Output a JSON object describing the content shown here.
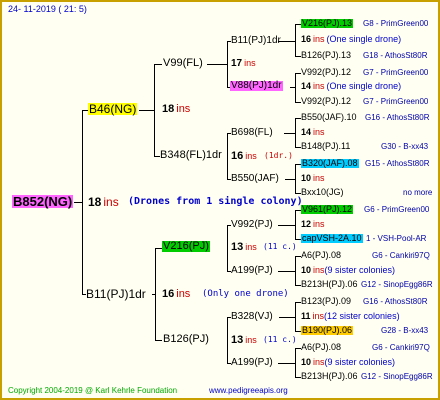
{
  "header": {
    "date": "24- 11-2019 ( 21: 5)"
  },
  "colors": {
    "yellow": "#ffff00",
    "green": "#00cc00",
    "magenta": "#ff66ff",
    "cyan": "#00ccff",
    "orange": "#ffcc00",
    "line": "#000000",
    "ins": "#cc0000",
    "note": "#0000cc",
    "frame": "#c8a000"
  },
  "queen": {
    "name": "B852(NG)",
    "ins_val": "18",
    "ins_word": "ins",
    "note": "(Drones from 1 single colony)"
  },
  "gen1": {
    "dam": {
      "name": "B46(NG)",
      "ins_val": "18",
      "ins_word": "ins"
    },
    "sire": {
      "name": "B11(PJ)1dr",
      "ins_val": "16",
      "ins_word": "ins",
      "note": "(Only one drone)"
    }
  },
  "gen2": {
    "d_dam": {
      "name": "V99(FL)"
    },
    "d_sire": {
      "name": "B348(FL)1dr",
      "ins_val": "16",
      "ins_word": "ins",
      "note": "(1dr.)"
    },
    "s_dam": {
      "name": "V216(PJ)",
      "ins_val": "13",
      "ins_word": "ins",
      "note": "(11 c.)"
    },
    "s_sire": {
      "name": "B126(PJ)",
      "ins_val": "13",
      "ins_word": "ins",
      "note": "(11 c.)"
    }
  },
  "gen3": {
    "a": {
      "name": "B11(PJ)1dr",
      "ins_val": "17",
      "ins_word": "ins"
    },
    "b": {
      "name": "V88(PJ)1dr"
    },
    "c": {
      "name": "B698(FL)",
      "ins_val": "14",
      "ins_word": "ins"
    },
    "d": {
      "name": "B550(JAF)",
      "ins_val": "10",
      "ins_word": "ins"
    },
    "e": {
      "name": "V992(PJ)",
      "ins_val": "12",
      "ins_word": "ins"
    },
    "f": {
      "name": "A199(PJ)",
      "ins_val": "10",
      "ins_word": "ins"
    },
    "g": {
      "name": "B328(VJ)",
      "ins_val": "13",
      "ins_word": "ins"
    },
    "h": {
      "name": "A199(PJ)",
      "ins_val": "10",
      "ins_word": "ins"
    }
  },
  "gen4": [
    {
      "name": "V216(PJ).13",
      "note": "G8 - PrimGreen00"
    },
    {
      "ins_val": "16",
      "ins_word": "ins",
      "note": "(One single drone)"
    },
    {
      "name": "B126(PJ).13",
      "note": "G18 - AthosSt80R"
    },
    {
      "name": "V992(PJ).12",
      "note": "G7 - PrimGreen00"
    },
    {
      "ins_val": "14",
      "ins_word": "ins",
      "note": "(One single drone)"
    },
    {
      "name": "V992(PJ).12",
      "note": "G7 - PrimGreen00"
    },
    {
      "name": "B550(JAF).10",
      "note": "G16 - AthosSt80R"
    },
    {
      "ins_val": "14",
      "ins_word": "ins"
    },
    {
      "name": "B148(PJ).11",
      "note": "G30 - B-xx43"
    },
    {
      "name": "B320(JAF).08",
      "note": "G15 - AthosSt80R"
    },
    {
      "ins_val": "10",
      "ins_word": "ins"
    },
    {
      "name": "Bxx10(JG)",
      "note": "no more"
    },
    {
      "name": "V961(PJ).12",
      "note": "G6 - PrimGreen00"
    },
    {
      "ins_val": "12",
      "ins_word": "ins"
    },
    {
      "name": "capVSH-2A.10",
      "note": "1 - VSH-Pool-AR"
    },
    {
      "name": "A6(PJ).08",
      "note": "G6 - Cankiri97Q"
    },
    {
      "ins_val": "10",
      "ins_word": "ins",
      "note": "(9 sister colonies)"
    },
    {
      "name": "B213H(PJ).06",
      "note": "G12 - SinopEgg86R"
    },
    {
      "name": "B123(PJ).09",
      "note": "G16 - AthosSt80R"
    },
    {
      "ins_val": "11",
      "ins_word": "ins",
      "note": "(12 sister colonies)"
    },
    {
      "name": "B190(PJ).06",
      "note": "G28 - B-xx43"
    },
    {
      "name": "A6(PJ).08",
      "note": "G6 - Cankiri97Q"
    },
    {
      "ins_val": "10",
      "ins_word": "ins",
      "note": "(9 sister colonies)"
    },
    {
      "name": "B213H(PJ).06",
      "note": "G12 - SinopEgg86R"
    }
  ],
  "footer": {
    "copyright": "Copyright 2004-2019 @ Karl Kehrle Foundation",
    "site": "www.pedigreeapis.org"
  }
}
